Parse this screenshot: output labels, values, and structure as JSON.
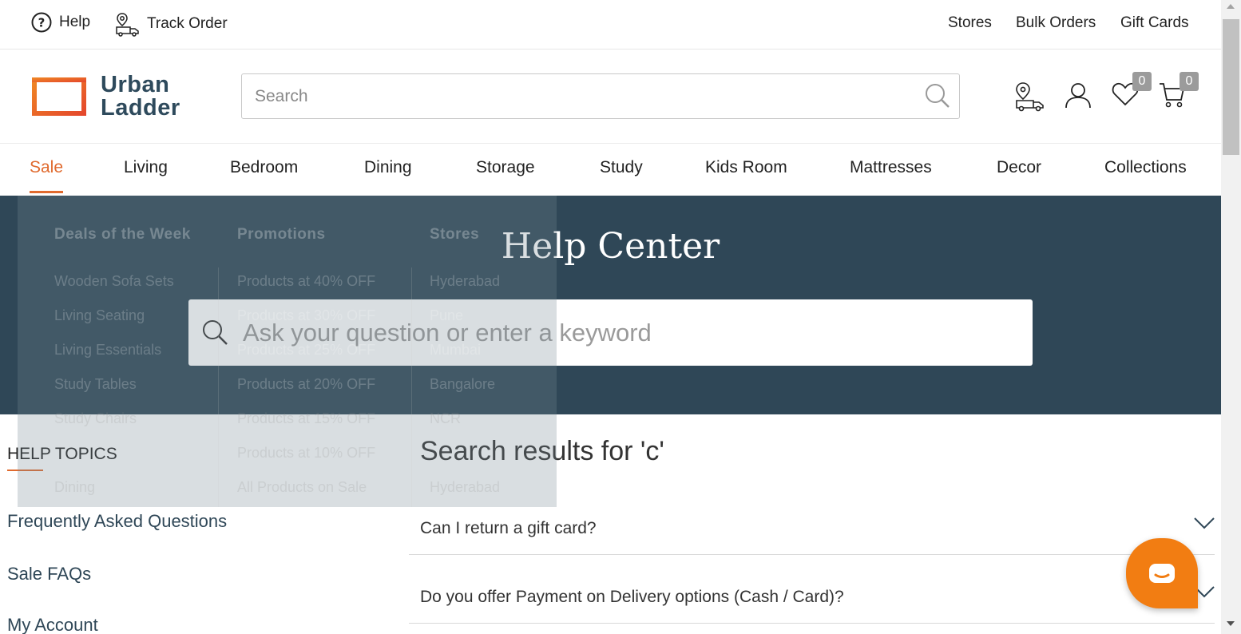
{
  "topbar": {
    "help_label": "Help",
    "track_label": "Track Order",
    "stores_label": "Stores",
    "bulk_label": "Bulk Orders",
    "gift_label": "Gift Cards"
  },
  "header": {
    "logo_line1": "Urban",
    "logo_line2": "Ladder",
    "search_placeholder": "Search",
    "wishlist_count": "0",
    "cart_count": "0"
  },
  "nav": {
    "items": [
      "Sale",
      "Living",
      "Bedroom",
      "Dining",
      "Storage",
      "Study",
      "Kids Room",
      "Mattresses",
      "Decor",
      "Collections"
    ]
  },
  "dropdown": {
    "col1_head": "Deals of the Week",
    "col1": [
      "Wooden Sofa Sets",
      "Living Seating",
      "Living Essentials",
      "Study Tables",
      "Study Chairs",
      "",
      "Dining"
    ],
    "col2_head": "Promotions",
    "col2": [
      "Products at 40% OFF",
      "Products at 30% OFF",
      "Products at 25% OFF",
      "Products at 20% OFF",
      "Products at 15% OFF",
      "Products at 10% OFF",
      "All Products on Sale"
    ],
    "col3_head": "Stores",
    "col3": [
      "Hyderabad",
      "Pune",
      "Mumbai",
      "Bangalore",
      "NCR",
      "",
      "Hyderabad"
    ]
  },
  "hero": {
    "title": "Help Center",
    "search_placeholder": "Ask your question or enter a keyword"
  },
  "sidebar": {
    "heading": "HELP TOPICS",
    "links": [
      "Frequently Asked Questions",
      "Sale FAQs",
      "My Account"
    ]
  },
  "results": {
    "title": "Search results for 'c'",
    "questions": [
      "Can I return a gift card?",
      "Do you offer Payment on Delivery options (Cash / Card)?"
    ]
  },
  "colors": {
    "accent": "#e06a2e",
    "hero_bg": "#2f4757",
    "chat": "#f27d12"
  }
}
